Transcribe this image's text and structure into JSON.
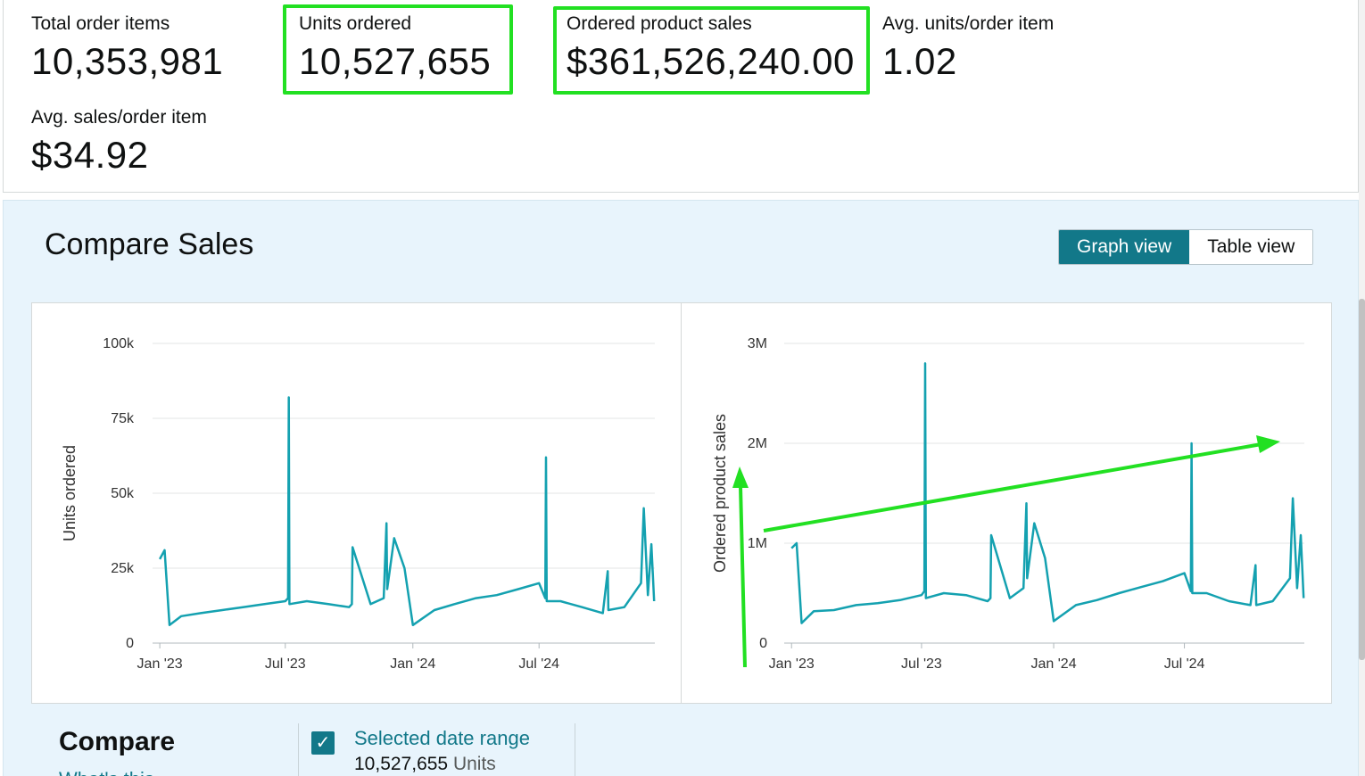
{
  "metrics": {
    "total_order_items": {
      "label": "Total order items",
      "value": "10,353,981"
    },
    "units_ordered": {
      "label": "Units ordered",
      "value": "10,527,655"
    },
    "ordered_product_sales": {
      "label": "Ordered product sales",
      "value": "$361,526,240.00"
    },
    "avg_units_per_order_item": {
      "label": "Avg. units/order item",
      "value": "1.02"
    },
    "avg_sales_per_order_item": {
      "label": "Avg. sales/order item",
      "value": "$34.92"
    }
  },
  "compare_sales": {
    "title": "Compare Sales",
    "graph_view_label": "Graph view",
    "table_view_label": "Table view"
  },
  "compare_section": {
    "heading": "Compare",
    "subtext": "What's this",
    "selected_range_label": "Selected date range",
    "selected_range_value": "10,527,655",
    "selected_range_unit": "Units"
  },
  "colors": {
    "series_line": "#14a1b0",
    "annotation_green": "#22e022",
    "accent": "#127889"
  },
  "chart_data": [
    {
      "type": "line",
      "ylabel": "Units ordered",
      "ylim": [
        0,
        100000
      ],
      "yticks": [
        "0",
        "25k",
        "50k",
        "75k",
        "100k"
      ],
      "xticks": [
        "Jan '23",
        "Jul '23",
        "Jan '24",
        "Jul '24"
      ],
      "series": [
        {
          "x": [
            "2023-01-01",
            "2023-01-08",
            "2023-01-15",
            "2023-02-01",
            "2023-03-01",
            "2023-04-01",
            "2023-05-01",
            "2023-06-01",
            "2023-07-01",
            "2023-07-05",
            "2023-07-06",
            "2023-07-07",
            "2023-08-01",
            "2023-09-01",
            "2023-10-01",
            "2023-10-05",
            "2023-10-06",
            "2023-11-01",
            "2023-11-20",
            "2023-11-24",
            "2023-11-25",
            "2023-12-05",
            "2023-12-20",
            "2024-01-01",
            "2024-02-01",
            "2024-03-01",
            "2024-04-01",
            "2024-05-01",
            "2024-06-01",
            "2024-07-01",
            "2024-07-10",
            "2024-07-11",
            "2024-07-12",
            "2024-08-01",
            "2024-09-01",
            "2024-10-01",
            "2024-10-08",
            "2024-10-09",
            "2024-11-01",
            "2024-11-25",
            "2024-11-29",
            "2024-12-05",
            "2024-12-10",
            "2024-12-14"
          ],
          "y": [
            28000,
            31000,
            6000,
            9000,
            10000,
            11000,
            12000,
            13000,
            14000,
            15000,
            82000,
            13000,
            14000,
            13000,
            12000,
            13000,
            32000,
            13000,
            15000,
            40000,
            18000,
            35000,
            25000,
            6000,
            11000,
            13000,
            15000,
            16000,
            18000,
            20000,
            15000,
            62000,
            14000,
            14000,
            12000,
            10000,
            24000,
            11000,
            12000,
            20000,
            45000,
            16000,
            33000,
            14000
          ]
        }
      ]
    },
    {
      "type": "line",
      "ylabel": "Ordered product sales",
      "ylim": [
        0,
        3000000
      ],
      "yticks": [
        "0",
        "1M",
        "2M",
        "3M"
      ],
      "xticks": [
        "Jan '23",
        "Jul '23",
        "Jan '24",
        "Jul '24"
      ],
      "series": [
        {
          "x": [
            "2023-01-01",
            "2023-01-08",
            "2023-01-15",
            "2023-02-01",
            "2023-03-01",
            "2023-04-01",
            "2023-05-01",
            "2023-06-01",
            "2023-07-01",
            "2023-07-05",
            "2023-07-06",
            "2023-07-07",
            "2023-08-01",
            "2023-09-01",
            "2023-10-01",
            "2023-10-05",
            "2023-10-06",
            "2023-11-01",
            "2023-11-20",
            "2023-11-24",
            "2023-11-25",
            "2023-12-05",
            "2023-12-20",
            "2024-01-01",
            "2024-02-01",
            "2024-03-01",
            "2024-04-01",
            "2024-05-01",
            "2024-06-01",
            "2024-07-01",
            "2024-07-10",
            "2024-07-11",
            "2024-07-12",
            "2024-08-01",
            "2024-09-01",
            "2024-10-01",
            "2024-10-08",
            "2024-10-09",
            "2024-11-01",
            "2024-11-25",
            "2024-11-29",
            "2024-12-05",
            "2024-12-10",
            "2024-12-14"
          ],
          "y": [
            950000,
            1000000,
            200000,
            320000,
            330000,
            380000,
            400000,
            430000,
            480000,
            520000,
            2800000,
            450000,
            500000,
            480000,
            420000,
            450000,
            1080000,
            450000,
            550000,
            1400000,
            650000,
            1200000,
            850000,
            220000,
            380000,
            430000,
            500000,
            560000,
            620000,
            700000,
            520000,
            2000000,
            500000,
            500000,
            420000,
            380000,
            780000,
            380000,
            420000,
            650000,
            1450000,
            550000,
            1080000,
            450000
          ]
        }
      ]
    }
  ]
}
